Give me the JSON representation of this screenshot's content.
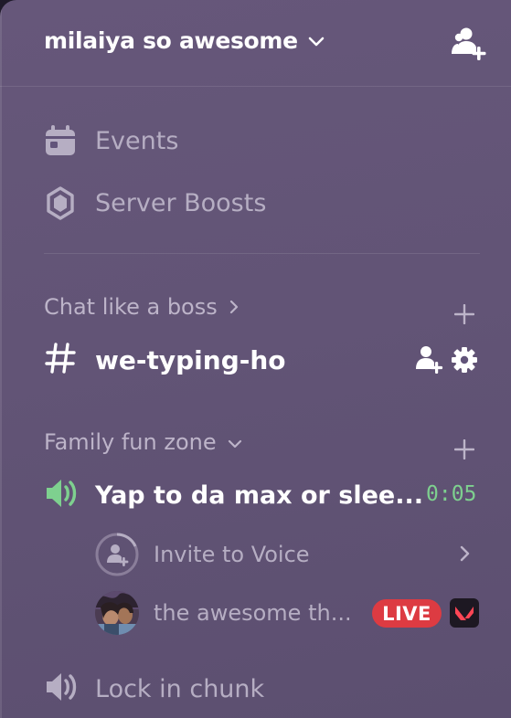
{
  "server": {
    "name": "milaiya so awesome"
  },
  "top_items": [
    {
      "label": "Events"
    },
    {
      "label": "Server Boosts"
    }
  ],
  "categories": [
    {
      "name": "Chat like a boss",
      "channels": [
        {
          "type": "text",
          "name": "we-typing-ho"
        }
      ]
    },
    {
      "name": "Family fun zone",
      "channels": [
        {
          "type": "voice",
          "name": "Yap to da max or slee...",
          "timer": "0:05",
          "sub_items": [
            {
              "label": "Invite to Voice"
            },
            {
              "label": "the awesome th...",
              "badge": "LIVE"
            }
          ]
        },
        {
          "type": "voice",
          "name": "Lock in chunk"
        }
      ]
    }
  ],
  "colors": {
    "accent_green": "#7ed08f",
    "live_red": "#dd3b42",
    "game_red": "#ff4655"
  }
}
